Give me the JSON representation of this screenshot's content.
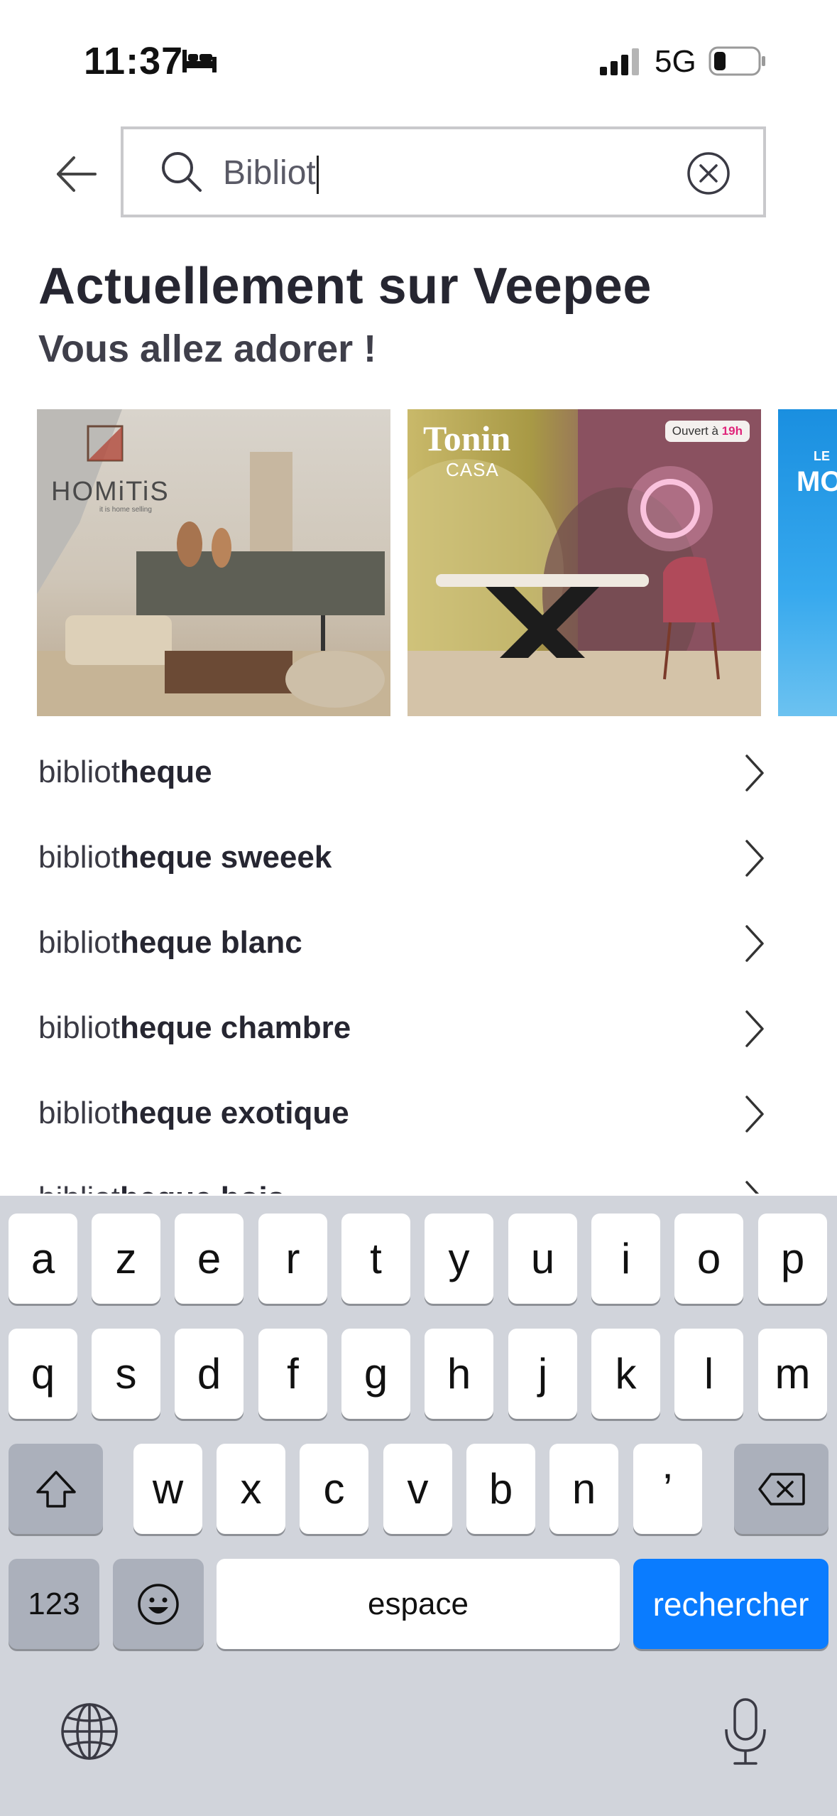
{
  "status": {
    "time": "11:37",
    "network": "5G"
  },
  "search": {
    "query": "Bibliot"
  },
  "heading": {
    "title": "Actuellement sur Veepee",
    "subtitle": "Vous allez adorer !"
  },
  "carousel": {
    "cards": [
      {
        "brand": "HOMiTiS",
        "tagline": "it is home selling"
      },
      {
        "brand": "Tonin",
        "sub": "CASA",
        "badge_prefix": "Ouvert à",
        "badge_hour": "19h"
      },
      {
        "brand_top": "LE",
        "brand_main": "MO"
      }
    ]
  },
  "suggestions": [
    {
      "prefix": "bibliot",
      "rest": "heque"
    },
    {
      "prefix": "bibliot",
      "rest": "heque sweeek"
    },
    {
      "prefix": "bibliot",
      "rest": "heque blanc"
    },
    {
      "prefix": "bibliot",
      "rest": "heque chambre"
    },
    {
      "prefix": "bibliot",
      "rest": "heque exotique"
    },
    {
      "prefix": "bibliot",
      "rest": "heque bois"
    }
  ],
  "keyboard": {
    "row1": [
      "a",
      "z",
      "e",
      "r",
      "t",
      "y",
      "u",
      "i",
      "o",
      "p"
    ],
    "row2": [
      "q",
      "s",
      "d",
      "f",
      "g",
      "h",
      "j",
      "k",
      "l",
      "m"
    ],
    "row3": [
      "w",
      "x",
      "c",
      "v",
      "b",
      "n",
      "’"
    ],
    "numbers_label": "123",
    "space_label": "espace",
    "action_label": "rechercher"
  },
  "colors": {
    "accent": "#0a7cff",
    "keyboard_bg": "#d1d4db"
  }
}
